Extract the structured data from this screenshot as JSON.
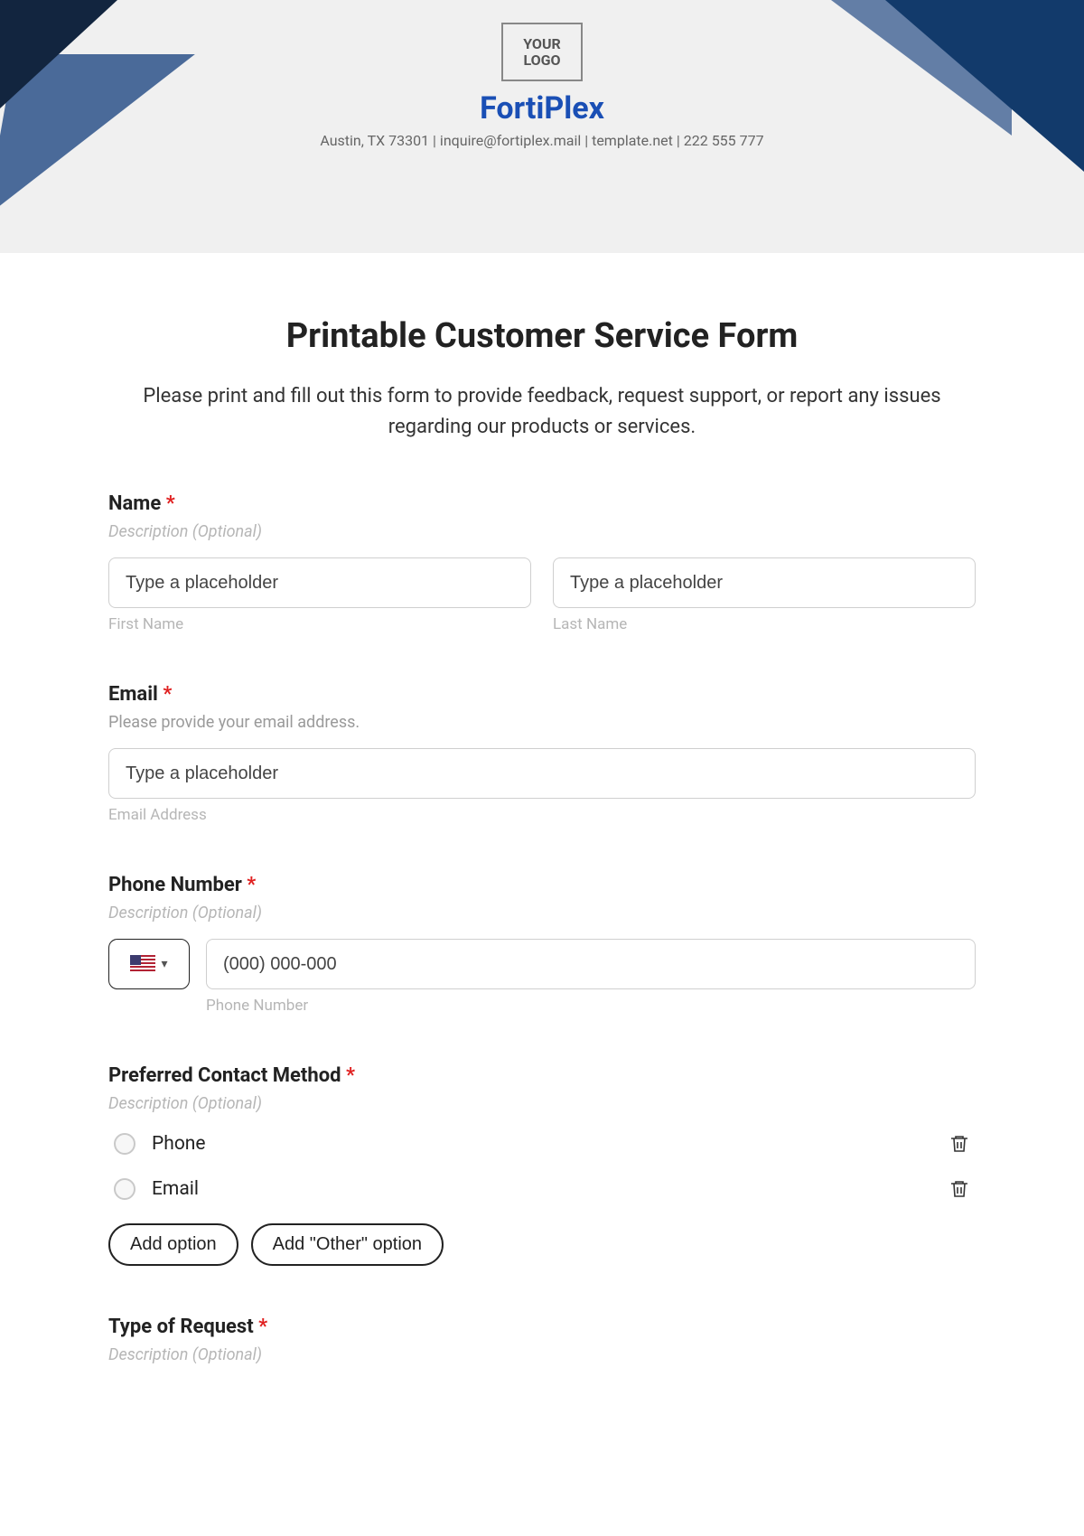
{
  "header": {
    "logo_text": "YOUR LOGO",
    "company_name": "FortiPlex",
    "info_line": "Austin, TX 73301 | inquire@fortiplex.mail | template.net | 222 555 777"
  },
  "form": {
    "title": "Printable Customer Service Form",
    "description": "Please print and fill out this form to provide feedback, request support, or report any issues regarding our products or services.",
    "fields": {
      "name": {
        "label": "Name",
        "required_marker": "*",
        "sub_desc": "Description (Optional)",
        "first_placeholder": "Type a placeholder",
        "first_sublabel": "First Name",
        "last_placeholder": "Type a placeholder",
        "last_sublabel": "Last Name"
      },
      "email": {
        "label": "Email",
        "required_marker": "*",
        "sub_desc": "Please provide your email address.",
        "placeholder": "Type a placeholder",
        "sublabel": "Email Address"
      },
      "phone": {
        "label": "Phone Number",
        "required_marker": "*",
        "sub_desc": "Description (Optional)",
        "placeholder": "(000) 000-000",
        "sublabel": "Phone Number"
      },
      "contact_method": {
        "label": "Preferred Contact Method",
        "required_marker": "*",
        "sub_desc": "Description (Optional)",
        "options": [
          "Phone",
          "Email"
        ],
        "add_option_label": "Add option",
        "add_other_label": "Add \"Other\" option"
      },
      "request_type": {
        "label": "Type of Request",
        "required_marker": "*",
        "sub_desc": "Description (Optional)"
      }
    }
  }
}
